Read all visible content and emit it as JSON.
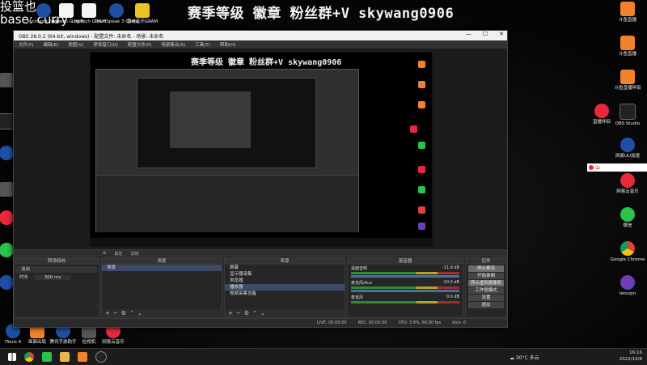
{
  "banner": "赛季等级 徽章 粉丝群+V skywang0906",
  "overlay": {
    "line1": "投篮也",
    "line2": "base: curry"
  },
  "desktop_left_icons": [
    {
      "label": "Microsoft Edge",
      "icon": "edge-icon"
    },
    {
      "label": "Logitech G HUB",
      "icon": "ghub-icon"
    },
    {
      "label": "Logitech G HUB",
      "icon": "ghub-icon"
    },
    {
      "label": "TeamSpeak 3 Client",
      "icon": "teamspeak-icon"
    },
    {
      "label": "雷电音乐GRAM",
      "icon": "music-icon"
    }
  ],
  "desktop_right_icons": [
    {
      "label": "斗鱼直播",
      "color": "orange"
    },
    {
      "label": "斗鱼直播",
      "color": "orange"
    },
    {
      "label": "斗鱼直播伴侣",
      "color": "orange"
    },
    {
      "label": "斗鱼直播",
      "color": "orange"
    },
    {
      "label": "直播伴侣",
      "color": "red"
    },
    {
      "label": "OBS Studio",
      "color": "dark"
    },
    {
      "label": "网易UU加速",
      "color": "blue"
    },
    {
      "label": "网易云音乐",
      "color": "red"
    },
    {
      "label": "微信",
      "color": "green"
    },
    {
      "label": "Google Chrome",
      "color": "chrome"
    },
    {
      "label": "letsvpn",
      "color": "purple"
    }
  ],
  "bottom_left_icons": [
    {
      "label": "iTools 4"
    },
    {
      "label": "画面出局"
    },
    {
      "label": "腾讯手游助手"
    },
    {
      "label": "检视机"
    },
    {
      "label": "网易云音乐"
    }
  ],
  "ime_label": "中",
  "obs": {
    "title": "OBS 28.0.2 (64-bit, windows) - 配置文件: 未命名 - 场景: 未命名",
    "menu": [
      "文件(F)",
      "编辑(E)",
      "视图(V)",
      "停靠窗口(D)",
      "配置文件(P)",
      "场景集合(S)",
      "工具(T)",
      "帮助(H)"
    ],
    "toolbar": [
      "属性",
      "滤镜"
    ],
    "mirror_banner": "赛季等级 徽章 粉丝群+V skywang0906",
    "docks": {
      "transitions": {
        "title": "转场特效",
        "type": "淡出",
        "duration_label": "时长",
        "duration": "300 ms"
      },
      "scenes": {
        "title": "场景",
        "items": [
          "场景"
        ]
      },
      "sources": {
        "title": "来源",
        "items": [
          "屏幕",
          "显示器采集",
          "浏览器",
          "播放器",
          "视频采集设备"
        ]
      },
      "mixer": {
        "title": "混音器",
        "channels": [
          {
            "name": "桌面音频",
            "db": "-11.9 dB"
          },
          {
            "name": "麦克风/Aux",
            "db": "-10.0 dB"
          },
          {
            "name": "麦克风",
            "db": "0.0 dB"
          }
        ]
      },
      "controls": {
        "title": "控件",
        "buttons": [
          "停止推流",
          "开始录制",
          "停止虚拟摄像机",
          "工作室模式",
          "设置",
          "退出"
        ]
      }
    },
    "status": [
      "LIVE: 00:00:00",
      "REC: 00:00:00",
      "CPU: 3.9%, 60.00 fps",
      "kb/s: 0"
    ]
  },
  "taskbar": {
    "weather": "30°C 多云",
    "time": "16:16",
    "date": "2022/10/8"
  }
}
